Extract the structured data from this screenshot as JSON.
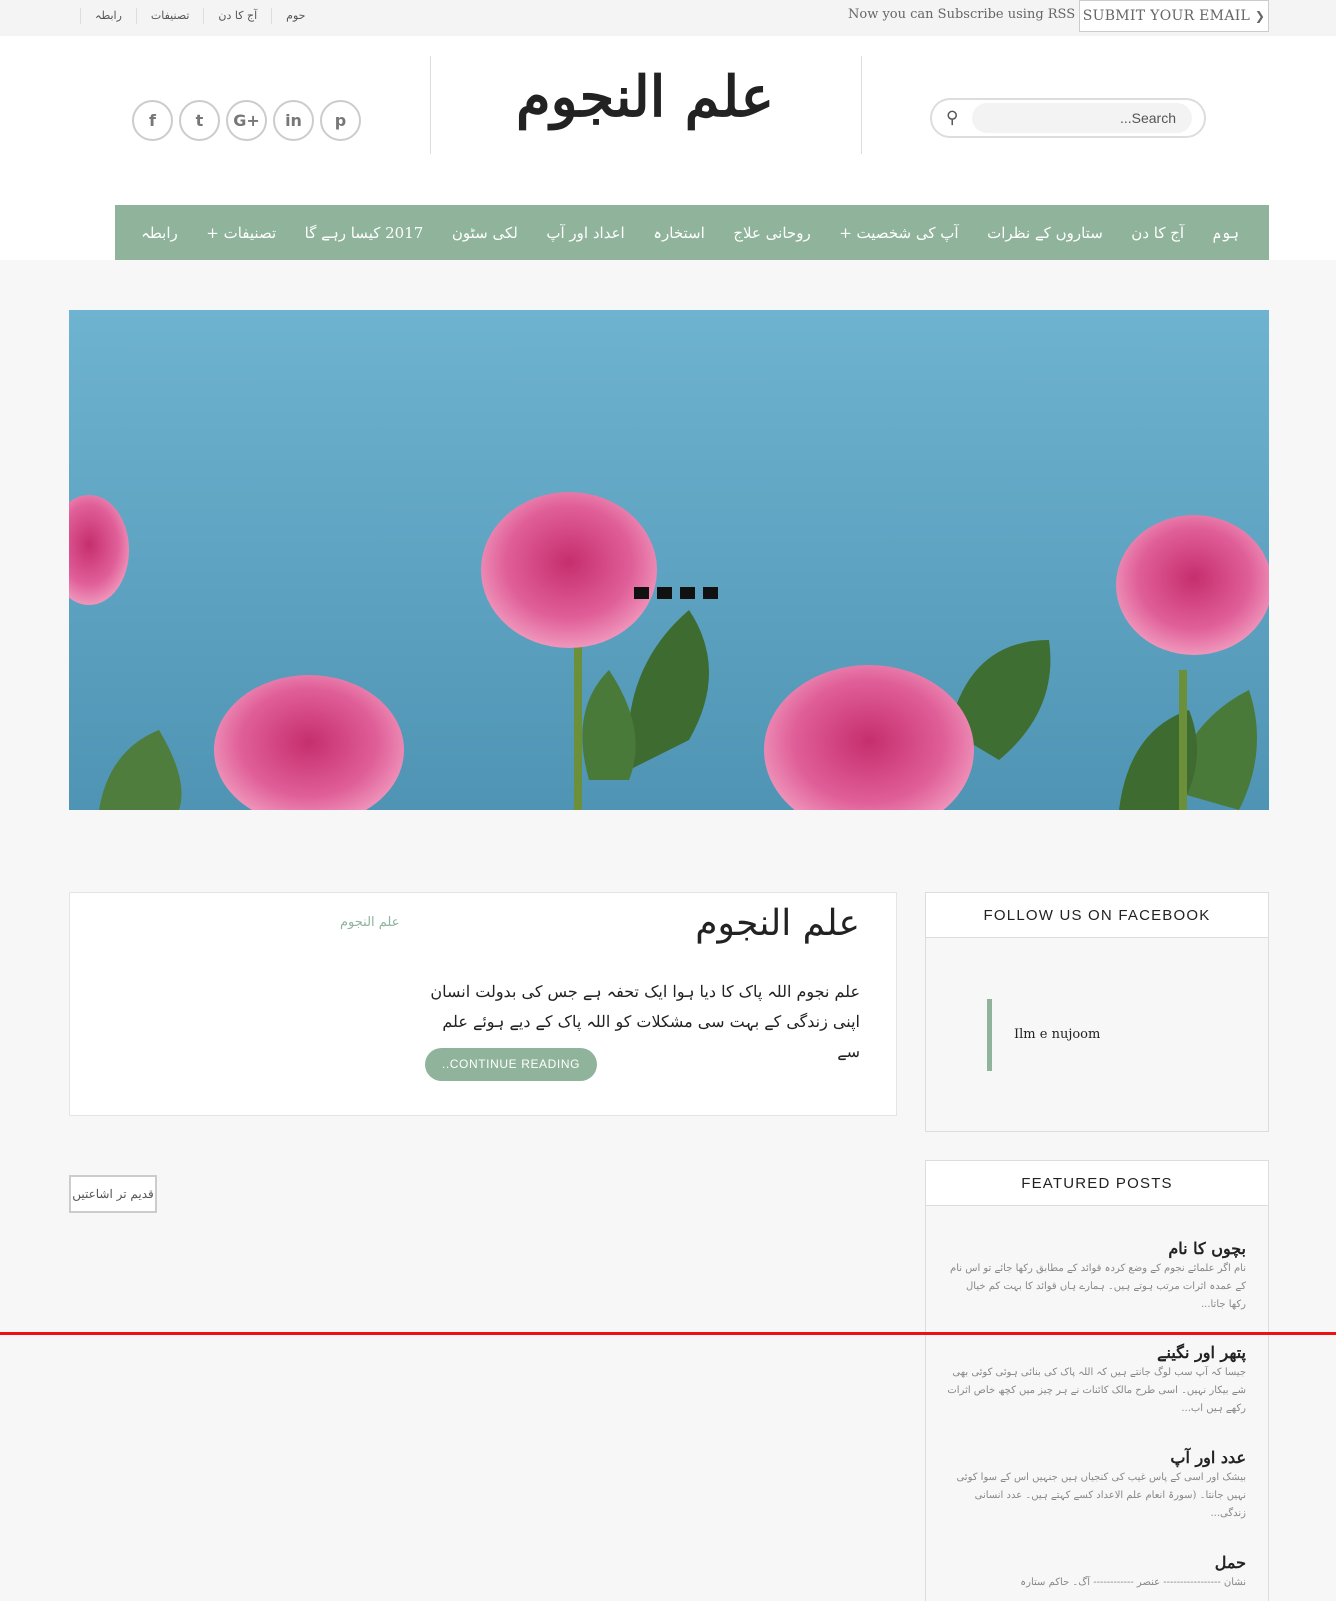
{
  "top_bar": {
    "links": [
      "حوم",
      "آج کا دن",
      "تصنیفات",
      "رابطہ"
    ],
    "rss_text": "Now you can Subscribe using RSS",
    "submit_label": "SUBMIT YOUR EMAIL"
  },
  "header": {
    "site_title": "علم النجوم",
    "social_icons": [
      "facebook-icon",
      "twitter-icon",
      "google-plus-icon",
      "linkedin-icon",
      "pinterest-icon"
    ],
    "social_glyphs": [
      "f",
      "t",
      "G+",
      "in",
      "p"
    ],
    "search_placeholder": "...Search"
  },
  "nav": {
    "items": [
      "ہوم",
      "آج کا دن",
      "ستاروں کے نظرات",
      "آپ کی شخصیت +",
      "روحانی علاج",
      "استخارہ",
      "اعداد اور آپ",
      "لکی سٹون",
      "2017 کیسا رہے گا",
      "تصنیفات +",
      "رابطہ"
    ]
  },
  "post": {
    "category": "علم النجوم",
    "title": "علم النجوم",
    "excerpt": "علم نجوم اللہ پاک کا دیا ہوا ایک تحفہ ہے جس کی بدولت انسان اپنی زندگی کے بہت سی مشکلات کو اللہ پاک کے دیے ہوئے علم سے",
    "continue_label": "..CONTINUE READING"
  },
  "pagination": {
    "older_label": "قدیم تر اشاعتیں"
  },
  "sidebar": {
    "facebook_heading": "FOLLOW US ON FACEBOOK",
    "facebook_page": "Ilm e nujoom",
    "featured_heading": "FEATURED POSTS",
    "featured": [
      {
        "title": "بچوں کا نام",
        "excerpt": "نام اگر علمائے نجوم کے وضع کردہ قوائد کے مطابق رکھا جائے تو اس نام کے عمدہ اثرات مرتب ہوتے ہیں۔ ہمارے ہاں قوائد کا بہت کم خیال رکھا جاتا..."
      },
      {
        "title": "پتھر اور نگینے",
        "excerpt": "جیسا کہ آپ سب لوگ جانتے ہیں کہ اللہ پاک کی بنائی ہوئی کوئی بھی شے بیکار نہیں۔ اسی طرح مالک کائنات نے ہر چیز میں کچھ خاص اثرات رکھے ہیں اب..."
      },
      {
        "title": "عدد اور آپ",
        "excerpt": "بیشک اور اسی کے پاس غیب کی کنجیاں ہیں جنہیں اس کے سوا کوئی نہیں جانتا۔ (سورۃ انعام علم الاعداد کسے کہتے ہیں۔ عدد انسانی زندگی..."
      },
      {
        "title": "حمل",
        "excerpt": "نشان ----------------- عنصر ------------ آگ۔ حاکم ستارہ"
      }
    ]
  },
  "colors": {
    "accent": "#8fb39b",
    "marker_line": "#ee1111"
  }
}
